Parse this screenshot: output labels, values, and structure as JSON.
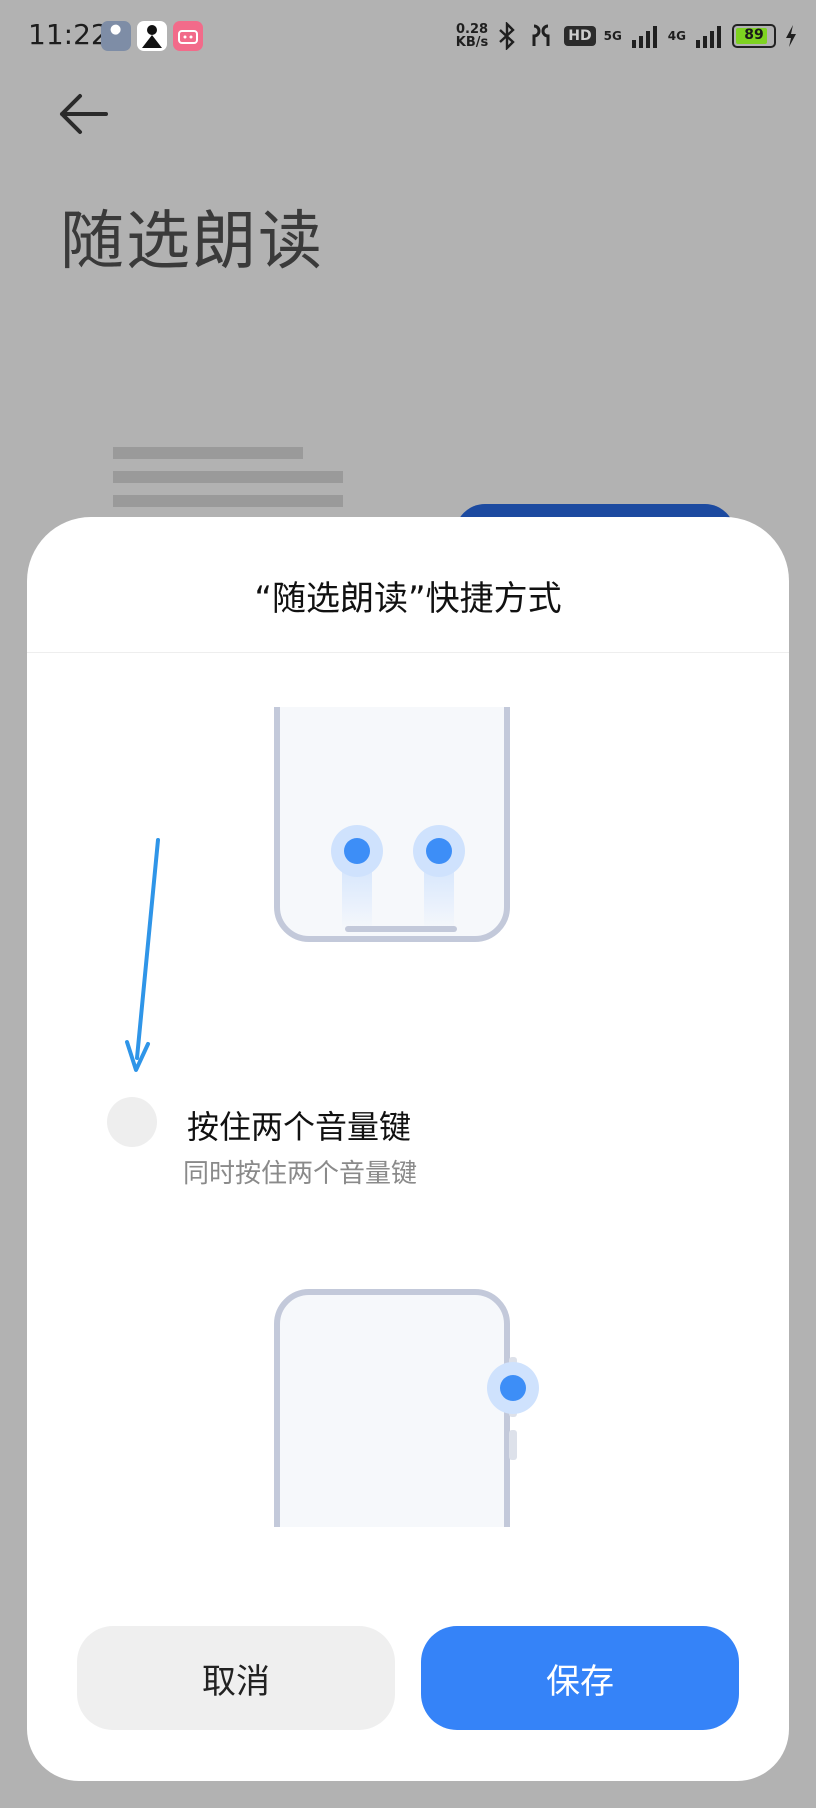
{
  "status_bar": {
    "time": "11:22",
    "speed_value": "0.28",
    "speed_unit": "KB/s",
    "hd_label": "HD",
    "net_5g": "5G",
    "net_4g": "4G",
    "battery": "89"
  },
  "page": {
    "title": "随选朗读"
  },
  "dialog": {
    "title": "“随选朗读”快捷方式",
    "option": {
      "title": "按住两个音量键",
      "subtitle": "同时按住两个音量键",
      "selected": false
    },
    "cancel_label": "取消",
    "save_label": "保存"
  },
  "colors": {
    "accent": "#3583f8",
    "scrim": "#b2b2b2",
    "illustration_dot": "#3d8ef7",
    "phone_outline": "#c3c9da",
    "annotation_arrow": "#2f95e8"
  }
}
